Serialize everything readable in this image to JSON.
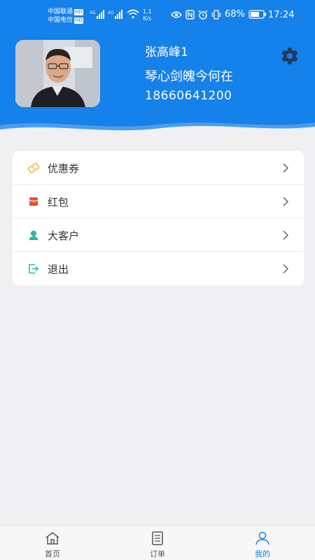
{
  "status_bar": {
    "carrier_1": "中国联通",
    "carrier_2": "中国电信",
    "hd_badge": "HD",
    "net_type": "4G",
    "speed_value": "1.1",
    "speed_unit": "K/s",
    "battery": "68%",
    "time": "17:24",
    "icons": [
      "eye-icon",
      "nfc-icon",
      "alarm-icon",
      "vibrate-icon",
      "battery-icon",
      "wifi-icon",
      "signal-icon"
    ]
  },
  "profile": {
    "name": "张高峰1",
    "motto": "琴心剑魄今何在",
    "phone": "18660641200"
  },
  "menu": {
    "items": [
      {
        "label": "优惠券",
        "icon": "coupon-icon",
        "color": "#e8b62b"
      },
      {
        "label": "红包",
        "icon": "red-packet-icon",
        "color": "#e84a3c"
      },
      {
        "label": "大客户",
        "icon": "user-icon",
        "color": "#2bb5a4"
      },
      {
        "label": "退出",
        "icon": "logout-icon",
        "color": "#2bb5a4"
      }
    ]
  },
  "tabbar": {
    "tabs": [
      {
        "label": "首页",
        "icon": "home-icon"
      },
      {
        "label": "订单",
        "icon": "order-list-icon"
      },
      {
        "label": "我的",
        "icon": "profile-icon",
        "active": true
      }
    ]
  },
  "colors": {
    "brand_blue": "#1581ea",
    "active_tab": "#1581ea",
    "background": "#f0f0f2"
  }
}
